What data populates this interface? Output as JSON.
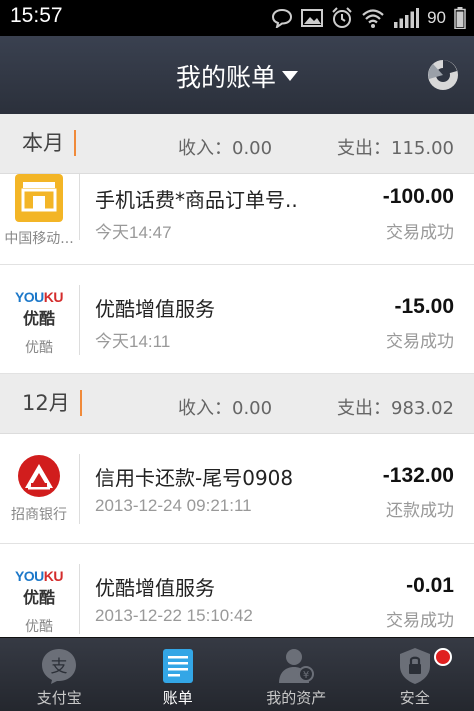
{
  "status_bar": {
    "time": "15:57",
    "battery_level": "90",
    "icons": [
      "chat-bubble-icon",
      "image-icon",
      "alarm-icon",
      "wifi-icon",
      "signal-icon",
      "battery-icon"
    ]
  },
  "header": {
    "title": "我的账单",
    "dropdown_icon": "caret-down-icon",
    "right_icon": "pie-chart-icon"
  },
  "sections": [
    {
      "month": "本月",
      "income": "收入：0.00",
      "expense": "支出：115.00",
      "transactions": [
        {
          "merchant_logo": "shop-icon",
          "merchant": "中国移动...",
          "name": "手机话费*商品订单号..",
          "date": "今天14:47",
          "amount": "-100.00",
          "status": "交易成功"
        },
        {
          "merchant_logo": "youku-logo",
          "merchant": "优酷",
          "name": "优酷增值服务",
          "date": "今天14:11",
          "amount": "-15.00",
          "status": "交易成功"
        }
      ]
    },
    {
      "month": "12月",
      "income": "收入：0.00",
      "expense": "支出：983.02",
      "transactions": [
        {
          "merchant_logo": "cmb-logo",
          "merchant": "招商银行",
          "name": "信用卡还款-尾号0908",
          "date": "2013-12-24 09:21:11",
          "amount": "-132.00",
          "status": "还款成功"
        },
        {
          "merchant_logo": "youku-logo",
          "merchant": "优酷",
          "name": "优酷增值服务",
          "date": "2013-12-22 15:10:42",
          "amount": "-0.01",
          "status": "交易成功"
        }
      ]
    }
  ],
  "logo_text": {
    "youku_en_1": "YOU",
    "youku_en_2": "KU",
    "youku_cn": "优酷"
  },
  "tabbar": {
    "tabs": [
      {
        "label": "支付宝",
        "icon": "alipay-icon",
        "active": false
      },
      {
        "label": "账单",
        "icon": "bill-icon",
        "active": true
      },
      {
        "label": "我的资产",
        "icon": "assets-user-icon",
        "active": false
      },
      {
        "label": "安全",
        "icon": "shield-lock-icon",
        "active": false,
        "badge": true
      }
    ]
  },
  "colors": {
    "header_bg": "#2f3541",
    "accent_orange": "#f08a3a",
    "active_tab_blue": "#33a6e6",
    "badge_red": "#e02020",
    "cmb_red": "#d11d1d",
    "china_mobile_yellow": "#f3b526"
  }
}
